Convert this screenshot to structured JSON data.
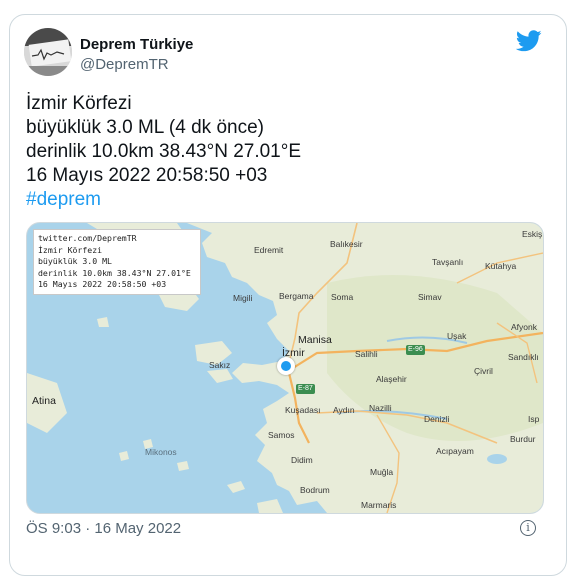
{
  "account": {
    "name": "Deprem Türkiye",
    "handle": "@DepremTR",
    "avatar_icon": "seismograph-photo-icon"
  },
  "brand": {
    "icon": "twitter-bird-icon",
    "color": "#1d9bf0"
  },
  "tweet": {
    "lines": [
      "İzmir Körfezi",
      "büyüklük 3.0 ML (4 dk önce)",
      "derinlik 10.0km 38.43°N 27.01°E",
      "16 Mayıs 2022 20:58:50 +03"
    ],
    "hashtag": "#deprem"
  },
  "map": {
    "caption_lines": [
      "twitter.com/DepremTR",
      "İzmir Körfezi",
      "büyüklük 3.0 ML",
      "derinlik 10.0km 38.43°N 27.01°E",
      "16 Mayıs 2022 20:58:50 +03"
    ],
    "places": {
      "edremit": "Edremit",
      "balikesir": "Balıkesir",
      "eskis": "Eskiş",
      "tavsanli": "Tavşanlı",
      "kutahya": "Kütahya",
      "migili": "Migili",
      "bergama": "Bergama",
      "soma": "Soma",
      "simav": "Simav",
      "afyonk": "Afyonk",
      "manisa": "Manisa",
      "usak": "Uşak",
      "izmir": "İzmir",
      "salihli": "Salihli",
      "sandikli": "Sandıklı",
      "sakiz": "Sakız",
      "civril": "Çivril",
      "alasehir": "Alaşehir",
      "atina": "Atina",
      "kusadasi": "Kuşadası",
      "aydin": "Aydın",
      "nazilli": "Nazilli",
      "denizli": "Denizli",
      "isp": "Isp",
      "samos": "Samos",
      "burdur": "Burdur",
      "mikonos": "Mikonos",
      "didim": "Didim",
      "acipayam": "Acıpayam",
      "mugla": "Muğla",
      "bodrum": "Bodrum",
      "marmaris": "Marmaris"
    },
    "roads": {
      "e96": "E-96",
      "e87": "E-87"
    },
    "marker_icon": "location-marker-icon"
  },
  "footer": {
    "timestamp": "ÖS 9:03 · 16 May 2022",
    "info_icon": "info-icon",
    "info_glyph": "i"
  }
}
